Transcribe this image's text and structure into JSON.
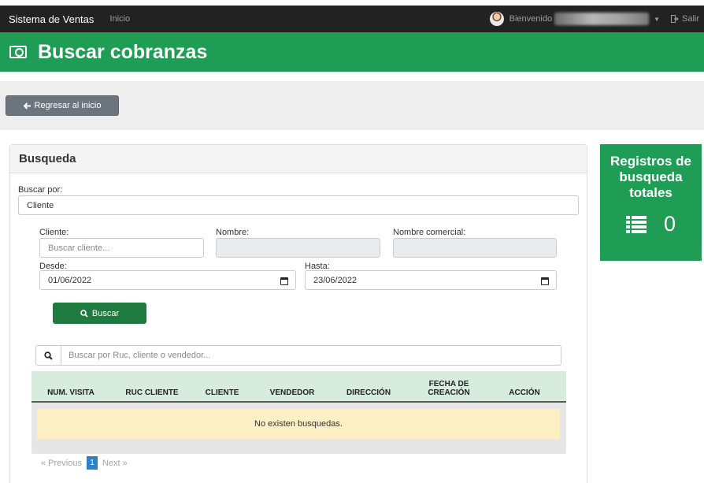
{
  "navbar": {
    "brand": "Sistema de Ventas",
    "home_link": "Inicio",
    "welcome": "Bienvenido",
    "logout": "Salir"
  },
  "header": {
    "title": "Buscar cobranzas",
    "icon": "money-bill-icon"
  },
  "back_button": {
    "label": "Regresar al inicio",
    "icon": "arrow-left-icon"
  },
  "search_panel": {
    "heading": "Busqueda",
    "search_by_label": "Buscar por:",
    "search_by_value": "Cliente",
    "client_label": "Cliente:",
    "client_placeholder": "Buscar cliente...",
    "name_label": "Nombre:",
    "trade_name_label": "Nombre comercial:",
    "from_label": "Desde:",
    "from_value": "01/06/2022",
    "to_label": "Hasta:",
    "to_value": "23/06/2022",
    "search_button": "Buscar"
  },
  "table": {
    "filter_placeholder": "Buscar por Ruc, cliente o vendedor...",
    "columns": [
      "NUM. VISITA",
      "RUC CLIENTE",
      "CLIENTE",
      "VENDEDOR",
      "DIRECCIÓN",
      "FECHA DE CREACIÓN",
      "ACCIÓN"
    ],
    "empty_message": "No existen busquedas."
  },
  "pagination": {
    "previous": "« Previous",
    "current": "1",
    "next": "Next »"
  },
  "stats": {
    "title": "Registros de busqueda totales",
    "value": "0"
  },
  "colors": {
    "primary_green": "#1f9d55",
    "dark_green": "#1f7a3f",
    "navbar": "#222222",
    "empty_row": "#fcefc4"
  }
}
